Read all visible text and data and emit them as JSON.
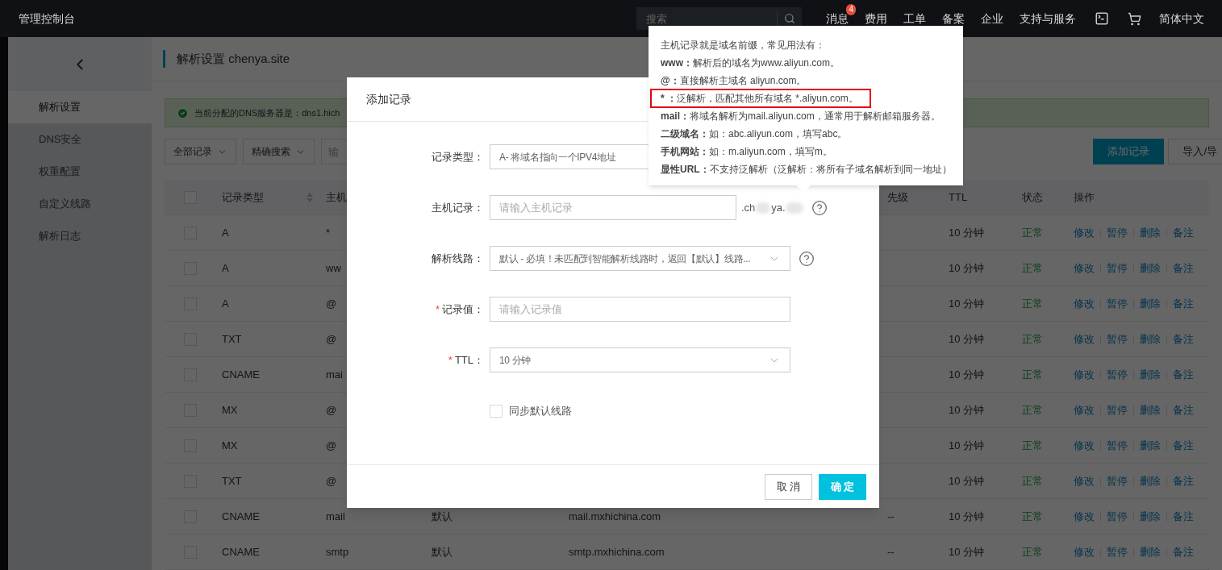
{
  "topbar": {
    "title": "管理控制台",
    "search": {
      "placeholder": "搜索"
    },
    "nav": [
      {
        "label": "消息",
        "badge": "4"
      },
      {
        "label": "费用"
      },
      {
        "label": "工单"
      },
      {
        "label": "备案"
      },
      {
        "label": "企业"
      },
      {
        "label": "支持与服务"
      }
    ],
    "language": "简体中文"
  },
  "sidebar": {
    "items": [
      {
        "label": "解析设置",
        "selected": true
      },
      {
        "label": "DNS安全",
        "selected": false
      },
      {
        "label": "权重配置",
        "selected": false
      },
      {
        "label": "自定义线路",
        "selected": false
      },
      {
        "label": "解析日志",
        "selected": false
      }
    ]
  },
  "page": {
    "title": "解析设置 chenya.site",
    "notice": "当前分配的DNS服务器是：dns1.hich",
    "filters": [
      "全部记录",
      "精确搜索"
    ],
    "search_placeholder": "输",
    "add_button": "添加记录",
    "import_button": "导入/导"
  },
  "table": {
    "header": {
      "checked": false,
      "type": "记录类型",
      "host": "主机",
      "priority": "先级",
      "ttl": "TTL",
      "status": "状态",
      "actions": "操作"
    },
    "rows": [
      {
        "checked": false,
        "type": "A",
        "host": "*",
        "ttl": "10 分钟",
        "status": "正常",
        "actions": [
          "修改",
          "暂停",
          "删除",
          "备注"
        ]
      },
      {
        "checked": false,
        "type": "A",
        "host": "ww",
        "ttl": "10 分钟",
        "status": "正常",
        "actions": [
          "修改",
          "暂停",
          "删除",
          "备注"
        ]
      },
      {
        "checked": false,
        "type": "A",
        "host": "@",
        "ttl": "10 分钟",
        "status": "正常",
        "actions": [
          "修改",
          "暂停",
          "删除",
          "备注"
        ]
      },
      {
        "checked": false,
        "type": "TXT",
        "host": "@",
        "ttl": "10 分钟",
        "status": "正常",
        "actions": [
          "修改",
          "暂停",
          "删除",
          "备注"
        ]
      },
      {
        "checked": false,
        "type": "CNAME",
        "host": "mai",
        "ttl": "10 分钟",
        "status": "正常",
        "actions": [
          "修改",
          "暂停",
          "删除",
          "备注"
        ]
      },
      {
        "checked": false,
        "type": "MX",
        "host": "@",
        "ttl": "10 分钟",
        "status": "正常",
        "actions": [
          "修改",
          "暂停",
          "删除",
          "备注"
        ]
      },
      {
        "checked": false,
        "type": "MX",
        "host": "@",
        "ttl": "10 分钟",
        "status": "正常",
        "actions": [
          "修改",
          "暂停",
          "删除",
          "备注"
        ]
      },
      {
        "checked": false,
        "type": "TXT",
        "host": "@",
        "ttl": "10 分钟",
        "status": "正常",
        "actions": [
          "修改",
          "暂停",
          "删除",
          "备注"
        ]
      },
      {
        "checked": false,
        "type": "CNAME",
        "host": "mail",
        "line": "默认",
        "value": "mail.mxhichina.com",
        "priority": "--",
        "ttl": "10 分钟",
        "status": "正常",
        "actions": [
          "修改",
          "暂停",
          "删除",
          "备注"
        ]
      },
      {
        "checked": false,
        "type": "CNAME",
        "host": "smtp",
        "line": "默认",
        "value": "smtp.mxhichina.com",
        "priority": "--",
        "ttl": "10 分钟",
        "status": "正常",
        "actions": [
          "修改",
          "暂停",
          "删除",
          "备注"
        ]
      }
    ]
  },
  "modal": {
    "title": "添加记录",
    "fields": [
      {
        "kind": "select",
        "label": "记录类型：",
        "value": "A- 将域名指向一个IPV4地址",
        "required": false
      },
      {
        "kind": "input",
        "label": "主机记录：",
        "placeholder": "请输入主机记录",
        "suffix": [
          ".ch",
          "ya."
        ],
        "required": false,
        "help": true
      },
      {
        "kind": "select",
        "label": "解析线路：",
        "value": "默认 - 必填！未匹配到智能解析线路时，返回【默认】线路...",
        "required": false,
        "help": true
      },
      {
        "kind": "input",
        "label": "记录值：",
        "placeholder": "请输入记录值",
        "required": true,
        "help": false
      },
      {
        "kind": "select",
        "label": "TTL：",
        "value": "10 分钟",
        "required": true,
        "help": false
      },
      {
        "kind": "checkbox",
        "label": "同步默认线路",
        "checked": false
      }
    ],
    "buttons": [
      {
        "label": "取 消",
        "primary": false
      },
      {
        "label": "确 定",
        "primary": true
      }
    ]
  },
  "tooltip": {
    "lines": [
      {
        "text": "主机记录就是域名前缀，常见用法有：",
        "highlighted": false
      },
      {
        "text": "**www：**解析后的域名为www.aliyun.com。",
        "highlighted": false
      },
      {
        "text": "**@：**直接解析主域名 aliyun.com。",
        "highlighted": false
      },
      {
        "text": "*** ：**泛解析，匹配其他所有域名 *.aliyun.com。",
        "highlighted": true
      },
      {
        "text": "**mail：**将域名解析为mail.aliyun.com，通常用于解析邮箱服务器。",
        "highlighted": false
      },
      {
        "text": "**二级域名：**如：abc.aliyun.com，填写abc。",
        "highlighted": false
      },
      {
        "text": "**手机网站：**如：m.aliyun.com，填写m。",
        "highlighted": false
      },
      {
        "text": "**显性URL：**不支持泛解析（泛解析：将所有子域名解析到同一地址）",
        "highlighted": false
      }
    ]
  }
}
